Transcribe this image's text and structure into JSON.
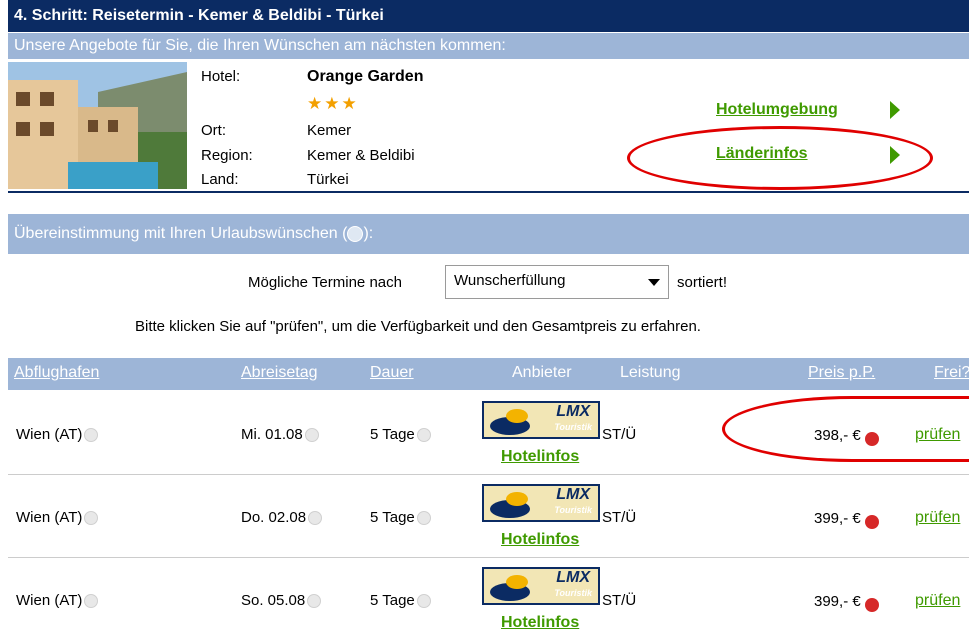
{
  "header": {
    "title": "4. Schritt: Reisetermin - Kemer & Beldibi - Türkei",
    "subtitle": "Unsere Angebote für Sie, die Ihren Wünschen am nächsten kommen:"
  },
  "hotel": {
    "hotel_label": "Hotel:",
    "hotel_name": "Orange Garden",
    "stars": 3,
    "star_glyphs": "★★★",
    "ort_label": "Ort:",
    "ort_value": "Kemer",
    "region_label": "Region:",
    "region_value": "Kemer & Beldibi",
    "land_label": "Land:",
    "land_value": "Türkei",
    "link_umgebung": "Hotelumgebung",
    "link_laender": "Länderinfos"
  },
  "preferences": {
    "title": "Übereinstimmung mit Ihren Urlaubswünschen (",
    "title_end": "):",
    "sort_prefix": "Mögliche Termine nach",
    "sort_value": "Wunscherfüllung",
    "sort_suffix": "sortiert!",
    "instruction": "Bitte klicken Sie auf \"prüfen\", um die Verfügbarkeit und den Gesamtpreis zu erfahren."
  },
  "table": {
    "headers": {
      "abflughafen": "Abflughafen",
      "abreisetag": "Abreisetag",
      "dauer": "Dauer",
      "anbieter": "Anbieter",
      "leistung": "Leistung",
      "preis": "Preis p.P.",
      "frei": "Frei?"
    },
    "rows": [
      {
        "airport": "Wien (AT)",
        "date": "Mi. 01.08",
        "duration": "5 Tage",
        "provider": "LMX",
        "provider_sub": "Touristik",
        "service": "ST/Ü",
        "hotel_link": "Hotelinfos",
        "price": "398,- €",
        "action": "prüfen"
      },
      {
        "airport": "Wien (AT)",
        "date": "Do. 02.08",
        "duration": "5 Tage",
        "provider": "LMX",
        "provider_sub": "Touristik",
        "service": "ST/Ü",
        "hotel_link": "Hotelinfos",
        "price": "399,- €",
        "action": "prüfen"
      },
      {
        "airport": "Wien (AT)",
        "date": "So. 05.08",
        "duration": "5 Tage",
        "provider": "LMX",
        "provider_sub": "Touristik",
        "service": "ST/Ü",
        "hotel_link": "Hotelinfos",
        "price": "399,- €",
        "action": "prüfen"
      }
    ]
  },
  "colors": {
    "header_navy": "#0b2b63",
    "bar_lightblue": "#9db5d7",
    "link_green": "#3f9a00",
    "highlight_red": "#e00000"
  }
}
